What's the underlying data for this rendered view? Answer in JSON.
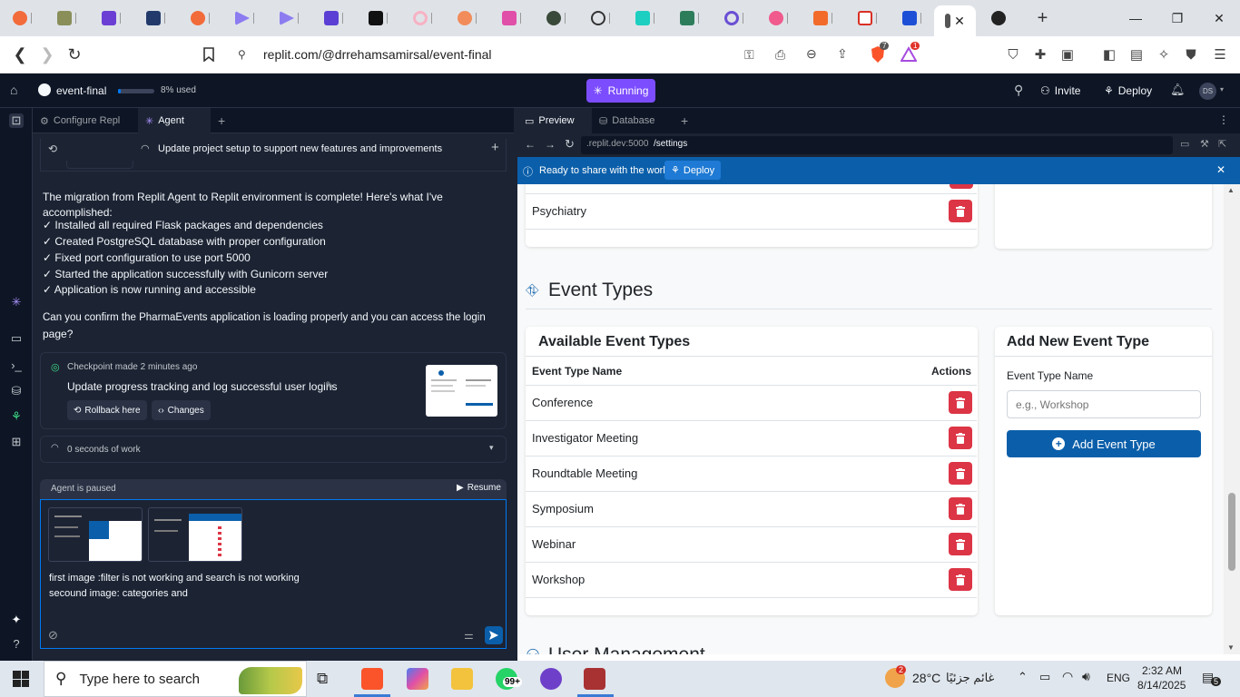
{
  "browser": {
    "active_tab_close": "✕",
    "url": "replit.com/@drrehamsamirsal/event-final",
    "extension_badges": {
      "brave": "7",
      "rewards": "1"
    }
  },
  "replit_header": {
    "project_name": "event-final",
    "usage_text": "8% used",
    "usage_fraction": 0.08,
    "run_status": "Running",
    "invite_label": "Invite",
    "deploy_label": "Deploy",
    "avatar_initials": "DS"
  },
  "left_pane": {
    "tabs": [
      "Configure Repl",
      "Agent"
    ],
    "thread_title": "Update project setup to support new features and improvements",
    "messages": {
      "intro": "The migration from Replit Agent to Replit environment is complete! Here's what I've accomplished:",
      "items": [
        "✓ Installed all required Flask packages and dependencies",
        "✓ Created PostgreSQL database with proper configuration",
        "✓ Fixed port configuration to use port 5000",
        "✓ Started the application successfully with Gunicorn server",
        "✓ Application is now running and accessible"
      ],
      "question_line1": "Can you confirm the PharmaEvents application is loading properly and you can access the login",
      "question_line2": "page?"
    },
    "checkpoint": {
      "meta": "Checkpoint made 2 minutes ago",
      "title": "Update progress tracking and log successful user logins",
      "rollback_label": "Rollback here",
      "changes_label": "Changes"
    },
    "work_summary": "0 seconds of work",
    "agent_status": "Agent is paused",
    "resume_label": "Resume",
    "compose_line1": "first image :filter is not working and search is not working",
    "compose_line2": "secound image: categories and"
  },
  "right_pane": {
    "tabs": [
      "Preview",
      "Database"
    ],
    "preview_url_prefix": ".replit.dev:5000",
    "preview_url_path": "/settings",
    "banner_text": "Ready to share with the world?",
    "banner_deploy": "Deploy",
    "prev_list_last": "Psychiatry",
    "section_title": "Event Types",
    "available_title": "Available Event Types",
    "col_name": "Event Type Name",
    "col_actions": "Actions",
    "event_types": [
      "Conference",
      "Investigator Meeting",
      "Roundtable Meeting",
      "Symposium",
      "Webinar",
      "Workshop"
    ],
    "add_title": "Add New Event Type",
    "add_field_label": "Event Type Name",
    "add_placeholder": "e.g., Workshop",
    "add_button": "Add Event Type",
    "next_section_partial": "User Management"
  },
  "taskbar": {
    "search_placeholder": "Type here to search",
    "whatsapp_badge": "99+",
    "weather_badge": "2",
    "temperature": "28°C",
    "weather_text": "غائم جزئيًا",
    "language": "ENG",
    "time": "2:32 AM",
    "date": "8/14/2025",
    "notifications": "5"
  },
  "colors": {
    "accent": "#7c4dff",
    "primary_btn": "#0b5faa",
    "danger": "#dc3545"
  }
}
